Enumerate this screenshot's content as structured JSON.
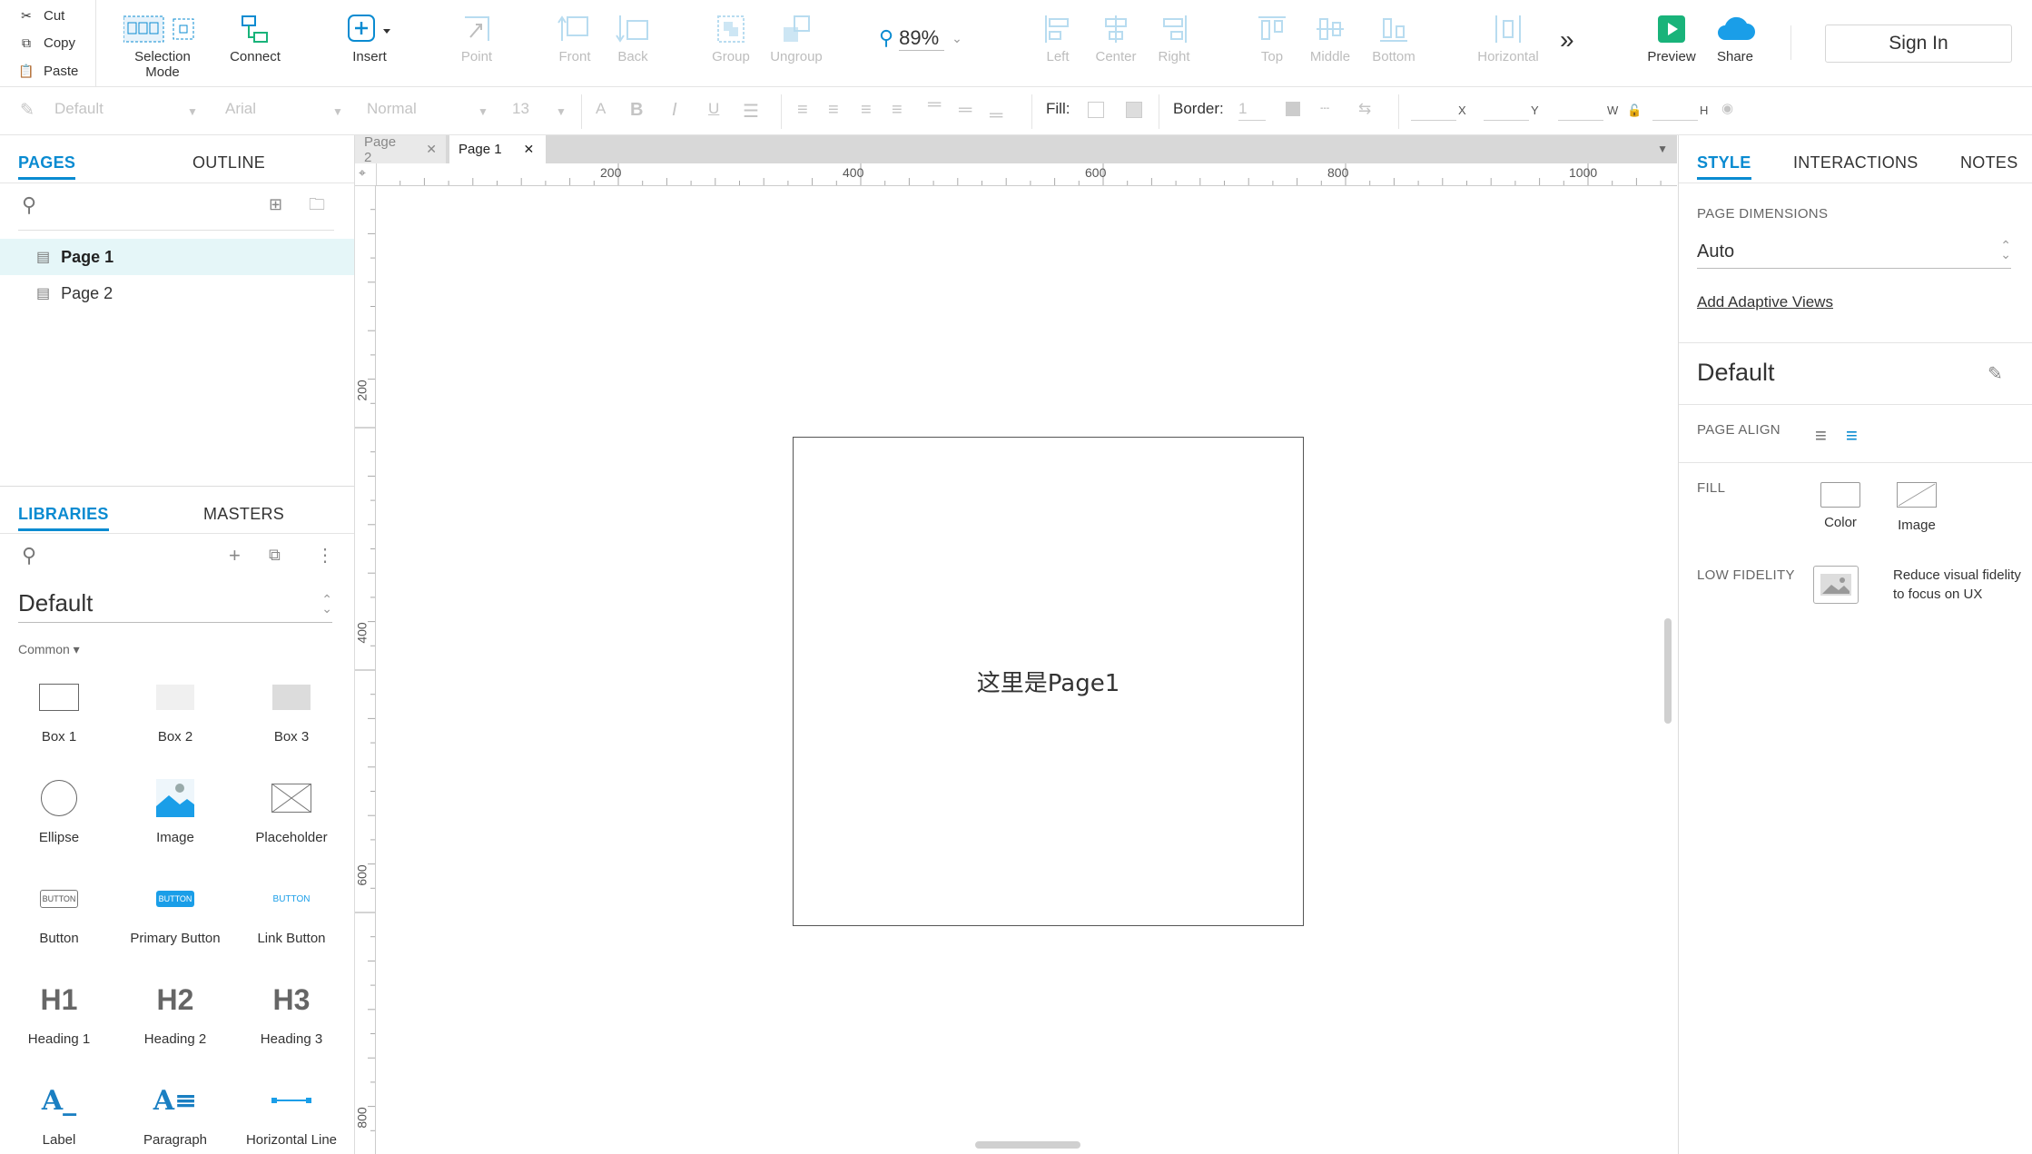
{
  "clipboard": {
    "cut": "Cut",
    "copy": "Copy",
    "paste": "Paste"
  },
  "toolbar": {
    "selection_mode": "Selection Mode",
    "connect": "Connect",
    "insert": "Insert",
    "point": "Point",
    "front": "Front",
    "back": "Back",
    "group": "Group",
    "ungroup": "Ungroup",
    "zoom": "89%",
    "left": "Left",
    "center": "Center",
    "right": "Right",
    "top": "Top",
    "middle": "Middle",
    "bottom": "Bottom",
    "horizontal": "Horizontal",
    "preview": "Preview",
    "share": "Share",
    "sign_in": "Sign In"
  },
  "format": {
    "style": "Default",
    "font": "Arial",
    "weight": "Normal",
    "size": "13",
    "fill_label": "Fill:",
    "border_label": "Border:",
    "border_value": "1",
    "x": "X",
    "y": "Y",
    "w": "W",
    "h": "H"
  },
  "left_panel": {
    "tabs": [
      "PAGES",
      "OUTLINE"
    ],
    "pages": [
      {
        "label": "Page 1",
        "selected": true
      },
      {
        "label": "Page 2",
        "selected": false
      }
    ],
    "lib_tabs": [
      "LIBRARIES",
      "MASTERS"
    ],
    "library": "Default",
    "category": "Common ▾",
    "widgets": [
      "Box 1",
      "Box 2",
      "Box 3",
      "Ellipse",
      "Image",
      "Placeholder",
      "Button",
      "Primary Button",
      "Link Button",
      "Heading 1",
      "Heading 2",
      "Heading 3",
      "Label",
      "Paragraph",
      "Horizontal Line"
    ],
    "widget_text": {
      "button": "BUTTON",
      "h1": "H1",
      "h2": "H2",
      "h3": "H3",
      "label": "A_",
      "paragraph": "A≡"
    }
  },
  "doc_tabs": [
    "Page 2",
    "Page 1"
  ],
  "ruler": {
    "top": [
      "200",
      "400",
      "600",
      "800",
      "1000"
    ],
    "left": [
      "200",
      "400",
      "600",
      "800"
    ]
  },
  "canvas": {
    "text": "这里是Page1"
  },
  "right_panel": {
    "tabs": [
      "STYLE",
      "INTERACTIONS",
      "NOTES"
    ],
    "page_dimensions_label": "PAGE DIMENSIONS",
    "page_dimensions": "Auto",
    "add_adaptive": "Add Adaptive Views",
    "style_name": "Default",
    "page_align": "PAGE ALIGN",
    "fill": "FILL",
    "fill_color": "Color",
    "fill_image": "Image",
    "low_fidelity": "LOW FIDELITY",
    "low_fidelity_desc": "Reduce visual fidelity to focus on UX"
  },
  "colors": {
    "accent": "#0a8bd1",
    "preview": "#19b37a",
    "share": "#1a9ee8",
    "canvas_border": "#555555"
  }
}
